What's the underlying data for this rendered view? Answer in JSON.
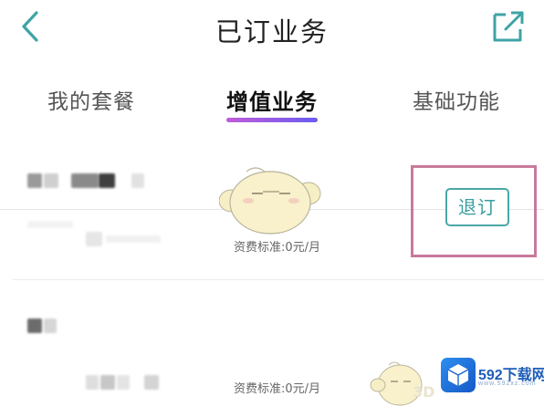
{
  "header": {
    "title": "已订业务",
    "back_icon": "chevron-left-icon",
    "share_icon": "external-link-icon",
    "accent": "#4aa7a8"
  },
  "tabs": [
    {
      "label": "我的套餐",
      "active": false
    },
    {
      "label": "增值业务",
      "active": true
    },
    {
      "label": "基础功能",
      "active": false
    }
  ],
  "tab_indicator_colors": [
    "#c05cd6",
    "#6a5cf2"
  ],
  "services": [
    {
      "fee": "资费标准:0元/月",
      "action_label": "退订",
      "highlighted": true
    },
    {
      "fee": "资费标准:0元/月"
    }
  ],
  "highlight_color": "#c87a9c",
  "watermark": {
    "title": "592下载网",
    "subtitle": "www.592xz.com",
    "extra": "3D"
  }
}
